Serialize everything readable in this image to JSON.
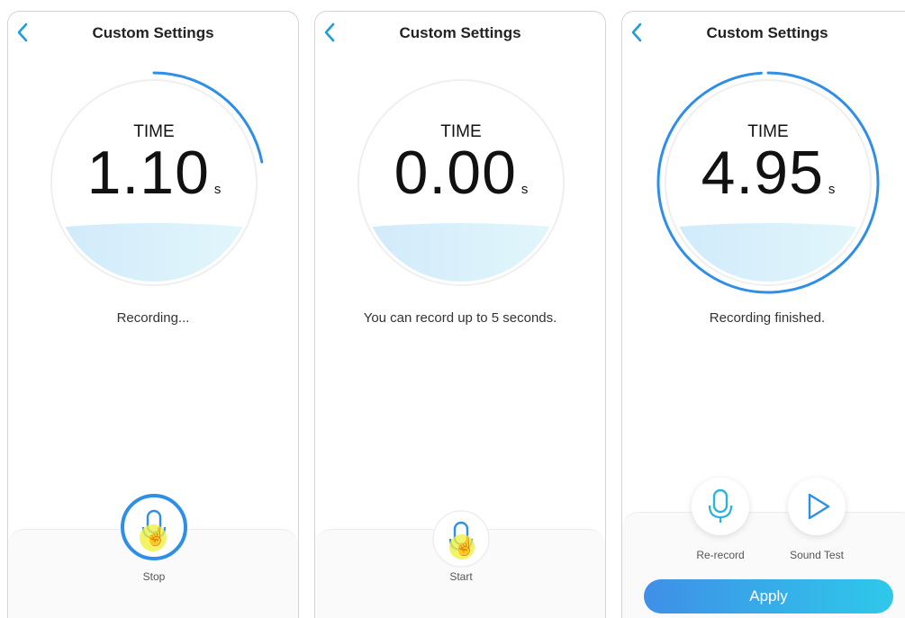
{
  "colors": {
    "accent_blue": "#2f8fe6",
    "back_arrow": "#1f9fd8",
    "apply_gradient_start": "#3f8fe7",
    "apply_gradient_end": "#2ec9ea",
    "water_light": "#dff4fb",
    "tap_highlight": "#eef03c"
  },
  "screens": [
    {
      "header": {
        "title": "Custom Settings",
        "back_icon": "chevron-left-icon"
      },
      "timer": {
        "label": "TIME",
        "value": "1.10",
        "unit": "s",
        "progress_fraction": 0.22
      },
      "status": "Recording...",
      "control": {
        "icon": "microphone-icon",
        "state": "recording",
        "label": "Stop"
      }
    },
    {
      "header": {
        "title": "Custom Settings",
        "back_icon": "chevron-left-icon"
      },
      "timer": {
        "label": "TIME",
        "value": "0.00",
        "unit": "s",
        "progress_fraction": 0.0
      },
      "status": "You can record up to 5 seconds.",
      "control": {
        "icon": "microphone-icon",
        "state": "idle",
        "label": "Start"
      }
    },
    {
      "header": {
        "title": "Custom Settings",
        "back_icon": "chevron-left-icon"
      },
      "timer": {
        "label": "TIME",
        "value": "4.95",
        "unit": "s",
        "progress_fraction": 0.99
      },
      "status": "Recording finished.",
      "actions": [
        {
          "icon": "microphone-icon",
          "label": "Re-record"
        },
        {
          "icon": "play-icon",
          "label": "Sound Test"
        }
      ],
      "apply_label": "Apply"
    }
  ]
}
